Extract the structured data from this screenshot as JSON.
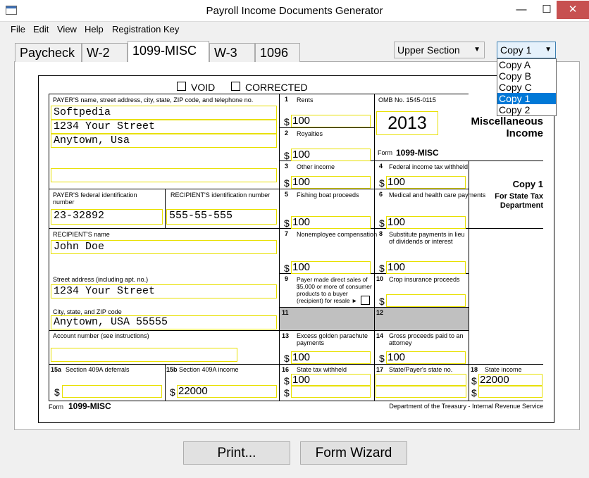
{
  "window": {
    "title": "Payroll Income Documents Generator",
    "minimize": "—",
    "maximize": "☐",
    "close": "✕"
  },
  "menu": [
    "File",
    "Edit",
    "View",
    "Help",
    "Registration Key"
  ],
  "tabs": [
    "Paycheck",
    "W-2",
    "1099-MISC",
    "W-3",
    "1096"
  ],
  "section_select": {
    "value": "Upper Section"
  },
  "copy_select": {
    "value": "Copy 1",
    "options": [
      "Copy A",
      "Copy B",
      "Copy C",
      "Copy 1",
      "Copy 2"
    ]
  },
  "form": {
    "void": "VOID",
    "corrected": "CORRECTED",
    "payer_label": "PAYER'S name, street address, city, state, ZIP code, and telephone no.",
    "payer_lines": [
      "Softpedia",
      "1234 Your Street",
      "Anytown, Usa",
      ""
    ],
    "payer_fid_label": "PAYER'S federal identification number",
    "payer_fid": "23-32892",
    "recipient_id_label": "RECIPIENT'S identification number",
    "recipient_id": "555-55-555",
    "recipient_name_label": "RECIPIENT'S name",
    "recipient_name": "John Doe",
    "street_label": "Street address (including apt. no.)",
    "street": "1234 Your Street",
    "city_label": "City, state, and ZIP code",
    "city": "Anytown, USA 55555",
    "account_label": "Account number (see instructions)",
    "account": "",
    "omb": "OMB No. 1545-0115",
    "year": "2013",
    "form_name_prefix": "Form",
    "form_name": "1099-MISC",
    "heading_title": "Miscellaneous Income",
    "copy_title": "Copy 1",
    "copy_sub": "For State Tax Department",
    "dept": "Department of the Treasury - Internal Revenue Service",
    "dollar": "$",
    "b1_label": "Rents",
    "b1": "100",
    "b2_label": "Royalties",
    "b2": "100",
    "b3_label": "Other income",
    "b3": "100",
    "b4_label": "Federal income tax withheld",
    "b4": "100",
    "b5_label": "Fishing boat proceeds",
    "b5": "100",
    "b6_label": "Medical and health care payments",
    "b6": "100",
    "b7_label": "Nonemployee compensation",
    "b7": "100",
    "b8_label": "Substitute payments in lieu of dividends or interest",
    "b8": "100",
    "b9_label": "Payer made direct sales of $5,000 or more of consumer products to a buyer (recipient) for resale ►",
    "b10_label": "Crop insurance proceeds",
    "b10": "",
    "b13_label": "Excess golden parachute payments",
    "b13": "100",
    "b14_label": "Gross proceeds paid to an attorney",
    "b14": "100",
    "b15a_label": "Section 409A deferrals",
    "b15a": "",
    "b15b_label": "Section 409A income",
    "b15b": "22000",
    "b16_label": "State tax withheld",
    "b16": "100",
    "b16b": "",
    "b17_label": "State/Payer's state no.",
    "b17": "",
    "b17b": "",
    "b18_label": "State income",
    "b18": "22000",
    "b18b": ""
  },
  "buttons": {
    "print": "Print...",
    "wizard": "Form Wizard"
  }
}
